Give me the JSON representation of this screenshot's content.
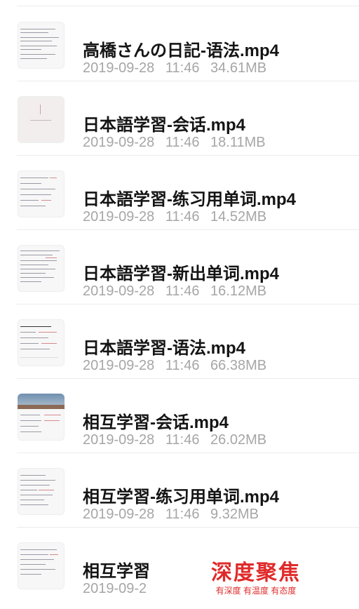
{
  "files": [
    {
      "title": "高橋さんの日記-语法.mp4",
      "date": "2019-09-28",
      "time": "11:46",
      "size": "34.61MB",
      "thumb_icon": "document-thumbnail"
    },
    {
      "title": "日本語学習-会话.mp4",
      "date": "2019-09-28",
      "time": "11:46",
      "size": "18.11MB",
      "thumb_icon": "blank-slide-thumbnail"
    },
    {
      "title": "日本語学習-练习用单词.mp4",
      "date": "2019-09-28",
      "time": "11:46",
      "size": "14.52MB",
      "thumb_icon": "document-thumbnail"
    },
    {
      "title": "日本語学習-新出单词.mp4",
      "date": "2019-09-28",
      "time": "11:46",
      "size": "16.12MB",
      "thumb_icon": "document-thumbnail"
    },
    {
      "title": "日本語学習-语法.mp4",
      "date": "2019-09-28",
      "time": "11:46",
      "size": "66.38MB",
      "thumb_icon": "document-thumbnail"
    },
    {
      "title": "相互学習-会话.mp4",
      "date": "2019-09-28",
      "time": "11:46",
      "size": "26.02MB",
      "thumb_icon": "photo-slide-thumbnail"
    },
    {
      "title": "相互学習-练习用单词.mp4",
      "date": "2019-09-28",
      "time": "11:46",
      "size": "9.32MB",
      "thumb_icon": "document-thumbnail"
    },
    {
      "title": "相互学習",
      "date": "2019-09-2",
      "time": "",
      "size": "",
      "thumb_icon": "document-thumbnail"
    }
  ],
  "watermark": {
    "main": "深度聚焦",
    "sub": "有深度 有温度 有态度"
  }
}
